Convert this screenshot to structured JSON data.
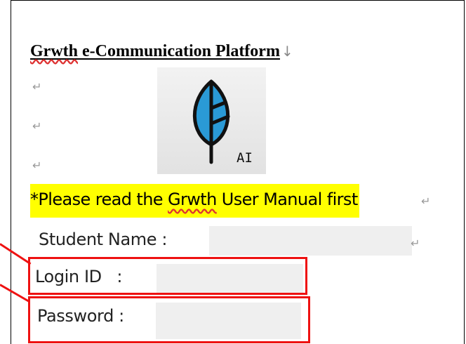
{
  "document": {
    "title_part1": "Grwth",
    "title_part2": " e-Communication Platform",
    "paragraph_mark": "↵",
    "down_mark": "↓",
    "logo": {
      "icon": "leaf-logo-icon",
      "text": "AI"
    },
    "note": {
      "prefix": "*Please read the ",
      "highlight_word": "Grwth",
      "suffix": " User Manual first"
    },
    "fields": {
      "student_name_label": "Student Name :",
      "student_name_value": "",
      "login_id_label": "Login ID   :",
      "login_id_value": "",
      "password_label": "Password :",
      "password_value": ""
    },
    "colors": {
      "highlight": "#ffff00",
      "annotation_red": "#ee1111",
      "logo_leaf": "#2a9ad6"
    }
  }
}
